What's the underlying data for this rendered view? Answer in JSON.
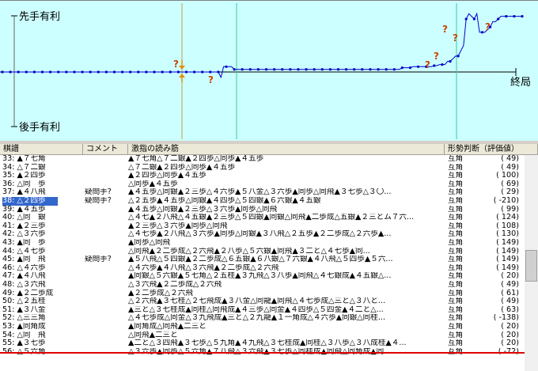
{
  "graph": {
    "label_top": "先手有利",
    "label_bottom": "後手有利",
    "label_end": "終局",
    "question_mark": "?",
    "evaluation_series": [
      0,
      0,
      0,
      0,
      0,
      0,
      0,
      0,
      0,
      0,
      0,
      0,
      0,
      0,
      0,
      0,
      0,
      0,
      0,
      0,
      0,
      0,
      0,
      0,
      0,
      0,
      0,
      0,
      0,
      0,
      0,
      0,
      0,
      0,
      0,
      0,
      0,
      0,
      0,
      0,
      0,
      0,
      0,
      0,
      0,
      0,
      0,
      0,
      0,
      0,
      0,
      0,
      0,
      0,
      0,
      0,
      0,
      0,
      0,
      0,
      0,
      0,
      0,
      0,
      0,
      0,
      0,
      0,
      0,
      0,
      0,
      0,
      0,
      0,
      0,
      0,
      0,
      0,
      0,
      0,
      0,
      0,
      -0.1,
      0.1,
      0.1,
      0.1,
      0.1,
      0.05,
      0.05,
      0.05,
      0.05,
      0.05,
      0.05,
      0.05,
      0.05,
      0.05,
      0.05,
      0.05,
      0.05,
      0.05,
      0.05,
      0.05,
      0.05,
      0.05,
      0.05,
      0.05,
      0.05,
      0.05,
      0.05,
      0.05,
      0.05,
      0.05,
      0.05,
      0.05,
      0.05,
      0.05,
      0.05,
      0.05,
      0.05,
      0.05,
      0.05,
      0.05,
      0.05,
      0.05,
      0.05,
      0.05,
      0.05,
      0.05,
      0.05,
      0.05,
      0.05,
      0.05,
      0.05,
      0.05,
      0.05,
      0.05,
      0.05,
      0.05,
      0.05,
      0.05,
      0.05,
      0.05,
      0.05,
      0.05,
      0.05,
      0.05,
      0.05,
      0.05,
      0.05,
      0.05,
      0.08,
      0.08,
      0.08,
      0.08,
      0.1,
      0.1,
      0.1,
      0.1,
      0.1,
      0.1,
      0.1,
      0.1,
      0.12,
      0.12,
      0.14,
      0.14,
      0.14,
      0.2,
      0.2,
      0.25,
      0.3,
      0.3,
      0.4,
      0.5,
      1.0,
      1.1,
      1.05,
      1.0,
      1.1,
      0.75,
      0.75,
      0.75,
      0.8,
      0.85,
      0.95,
      0.95,
      1.0,
      1.05,
      1.05,
      1.05,
      1.05,
      1.05,
      1.05,
      1.05,
      1.05,
      1.05
    ]
  },
  "grid": {
    "headers": [
      "棋譜",
      "コメント",
      "激指の読み筋",
      "形勢判断（評価値）"
    ],
    "rows": [
      {
        "move": "33: ▲７七角",
        "comment": "",
        "line": "▲７七角△７二銀▲２四歩△同歩▲４五歩",
        "judge": "互角",
        "value": "(      49)"
      },
      {
        "move": "34: △７二銀",
        "comment": "",
        "line": "△７二銀▲２四歩△同歩▲４五歩",
        "judge": "互角",
        "value": "(      49)"
      },
      {
        "move": "35: ▲２四歩",
        "comment": "",
        "line": "▲２四歩△同歩▲４五歩",
        "judge": "互角",
        "value": "(     100)"
      },
      {
        "move": "36: △同　歩",
        "comment": "",
        "line": "△同歩▲４五歩",
        "judge": "互角",
        "value": "(      69)"
      },
      {
        "move": "37: ▲４八飛",
        "comment": "疑問手?",
        "line": "▲４五歩△同銀▲２三歩△４六歩▲５八金△３六歩▲同歩△同飛▲３七歩△３〇...",
        "judge": "互角",
        "value": "(      29)"
      },
      {
        "move": "38: △２四歩",
        "comment": "疑問手?",
        "line": "△２五歩▲４五歩△同銀▲４四歩△５四銀▲６六銀▲４五銀",
        "judge": "互角",
        "value": "(    -210)"
      },
      {
        "move": "39: ▲４五歩",
        "comment": "",
        "line": "▲４五歩△同銀▲２三歩△３六歩▲同歩△同飛",
        "judge": "互角",
        "value": "(      99)"
      },
      {
        "move": "40: △同　銀",
        "comment": "",
        "line": "△４七▲２八飛△４五銀▲２三歩△５四銀▲同銀△同飛▲二歩成△五銀▲２三とム７六...",
        "judge": "互角",
        "value": "(     124)"
      },
      {
        "move": "41: ▲２三歩",
        "comment": "",
        "line": "▲２三歩△３六歩▲同歩△同飛",
        "judge": "互角",
        "value": "(     108)"
      },
      {
        "move": "42: △３六歩",
        "comment": "",
        "line": "△４七歩▲２八飛△３六歩▲同歩△同銀▲３八飛△２五歩▲２二歩成△２六歩▲...",
        "judge": "互角",
        "value": "(     130)"
      },
      {
        "move": "43: ▲同　歩",
        "comment": "",
        "line": "▲同歩△同飛",
        "judge": "互角",
        "value": "(     149)"
      },
      {
        "move": "44: △４七歩",
        "comment": "",
        "line": "△同飛▲２二歩成△２六飛▲２八歩△５六銀▲同飛▲３二と△４七歩▲同...",
        "judge": "互角",
        "value": "(     149)"
      },
      {
        "move": "45: ▲同　飛",
        "comment": "疑問手?",
        "line": "▲５八飛△５四銀▲２二歩成△６五銀▲６八銀△７六銀▲４八飛△５四歩▲５六...",
        "judge": "互角",
        "value": "(     149)"
      },
      {
        "move": "46: △４六歩",
        "comment": "",
        "line": "△４六歩▲４八飛△３六飛▲２二歩成△２六飛",
        "judge": "互角",
        "value": "(     149)"
      },
      {
        "move": "47: ▲４八飛",
        "comment": "",
        "line": "▲同銀△５六銀▲５七角△２五桂▲３九飛△３八歩▲同飛△４七銀成▲４五銀△...",
        "judge": "互角",
        "value": "(      20)"
      },
      {
        "move": "48: △３六飛",
        "comment": "",
        "line": "△３六飛▲２二歩成△２六飛",
        "judge": "互角",
        "value": "(      49)"
      },
      {
        "move": "49: ▲２二歩成",
        "comment": "",
        "line": "▲２二歩成△２六飛",
        "judge": "互角",
        "value": "(      61)"
      },
      {
        "move": "50: △２五桂",
        "comment": "",
        "line": "△２六飛▲３七桂△２七飛成▲３八金△同龍▲同飛△４七歩成△三と△３八と...",
        "judge": "互角",
        "value": "(      49)"
      },
      {
        "move": "51: ▲３八金",
        "comment": "",
        "line": "▲三と△３七桂成▲同桂△同飛成▲４三歩△同金▲４四歩△５四金▲４二と△...",
        "judge": "互角",
        "value": "(      63)"
      },
      {
        "move": "52: △三三角",
        "comment": "",
        "line": "△４七歩成△同金△３九飛成▲三と△２九龍▲１一角成△４六歩▲同銀△同桂...",
        "judge": "互角",
        "value": "(    -138)"
      },
      {
        "move": "53: ▲同角成",
        "comment": "",
        "line": "▲同角成△同飛▲二三と",
        "judge": "互角",
        "value": "(      20)"
      },
      {
        "move": "54: △同　飛",
        "comment": "",
        "line": "△同飛▲二三と",
        "judge": "互角",
        "value": "(      20)"
      },
      {
        "move": "55: ▲３七歩",
        "comment": "",
        "line": "▲二と△３四飛▲３七歩△５九角▲４九飛△３七桂成▲同桂△３八歩△３八成桂▲４...",
        "judge": "互角",
        "value": "(      20)"
      },
      {
        "move": "56: △５六角",
        "comment": "",
        "line": "△３六歩▲同歩△５六角▲７八飛△３六飛▲３七歩△同桂成▲同飛△同角成▲同...",
        "judge": "互角",
        "value": "(     -72)"
      }
    ],
    "selected_index": 5
  }
}
